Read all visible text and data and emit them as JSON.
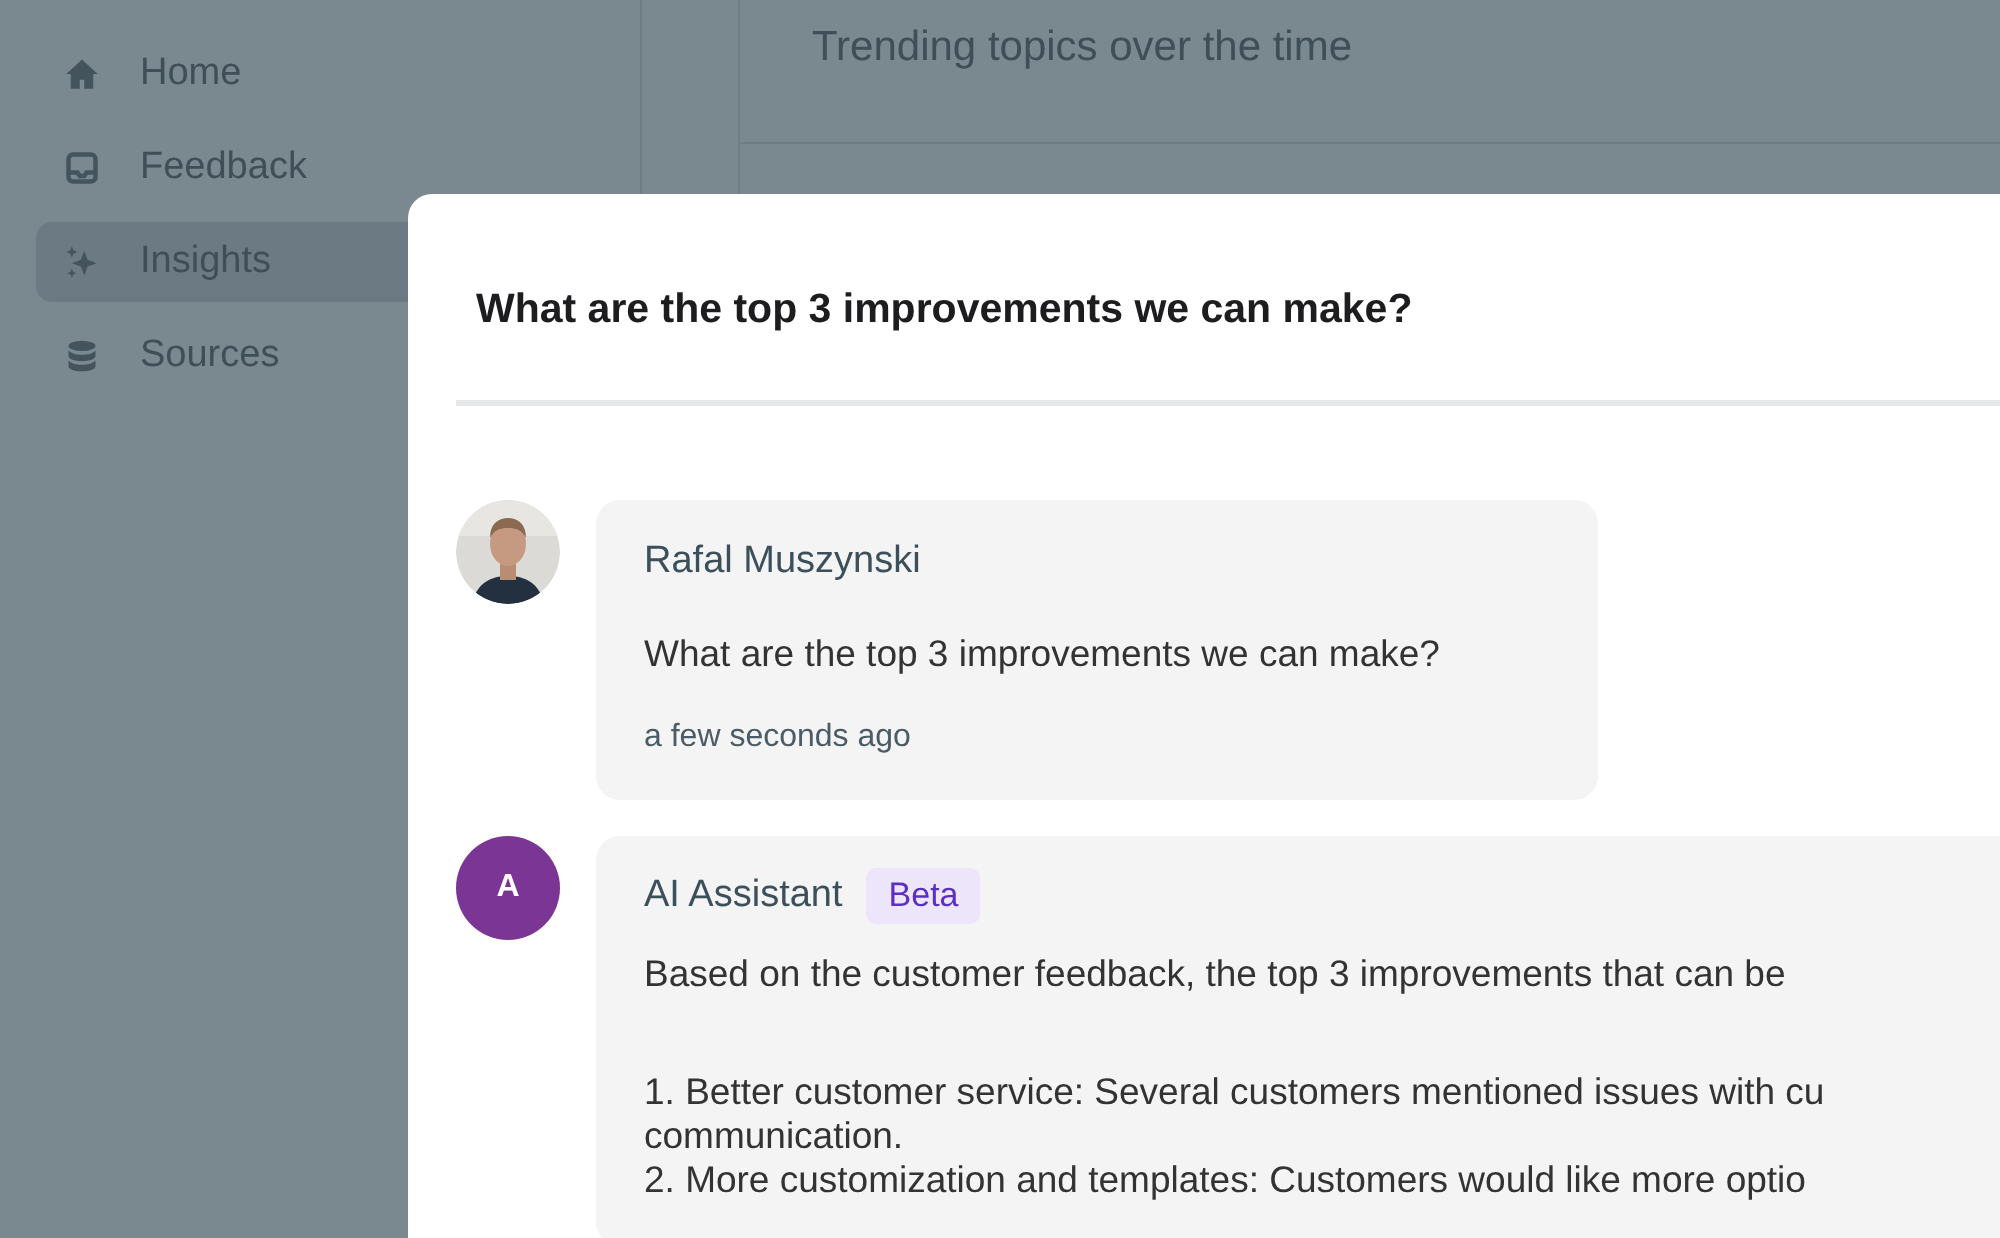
{
  "sidebar": {
    "items": [
      {
        "label": "Home",
        "selected": false
      },
      {
        "label": "Feedback",
        "selected": false
      },
      {
        "label": "Insights",
        "selected": true
      },
      {
        "label": "Sources",
        "selected": false
      }
    ]
  },
  "main": {
    "title": "Trending topics over the time"
  },
  "dialog": {
    "title": "What are the top 3 improvements we can make?",
    "messages": [
      {
        "kind": "user",
        "author": "Rafal Muszynski",
        "text": "What are the top 3 improvements we can make?",
        "time": "a few seconds ago"
      },
      {
        "kind": "assistant",
        "author": "AI Assistant",
        "avatar": {
          "kind": "initial",
          "letter": "A"
        },
        "badge": "Beta",
        "intro": "Based on the customer feedback, the top 3 improvements that can be",
        "points": [
          "1. Better customer service: Several customers mentioned issues with cu",
          "communication.",
          "2. More customization and templates: Customers would like more optio"
        ]
      }
    ]
  }
}
